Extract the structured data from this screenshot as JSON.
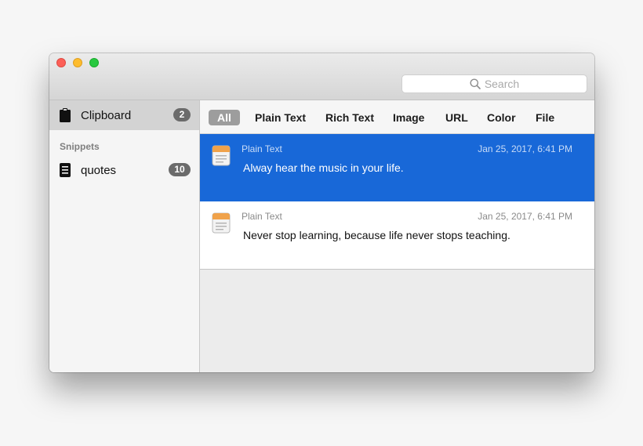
{
  "search": {
    "placeholder": "Search"
  },
  "sidebar": {
    "clipboard": {
      "label": "Clipboard",
      "count": "2"
    },
    "section_title": "Snippets",
    "snippets": [
      {
        "label": "quotes",
        "count": "10"
      }
    ]
  },
  "filters": [
    "All",
    "Plain Text",
    "Rich Text",
    "Image",
    "URL",
    "Color",
    "File"
  ],
  "active_filter": "All",
  "clips": [
    {
      "type": "Plain Text",
      "date": "Jan 25, 2017, 6:41 PM",
      "text": "Alway hear the music in your life.",
      "selected": true
    },
    {
      "type": "Plain Text",
      "date": "Jan 25, 2017, 6:41 PM",
      "text": "Never stop learning, because life never stops teaching.",
      "selected": false
    }
  ],
  "colors": {
    "selection": "#1868d8",
    "badge": "#6b6b6b",
    "active_filter": "#9d9d9d"
  }
}
